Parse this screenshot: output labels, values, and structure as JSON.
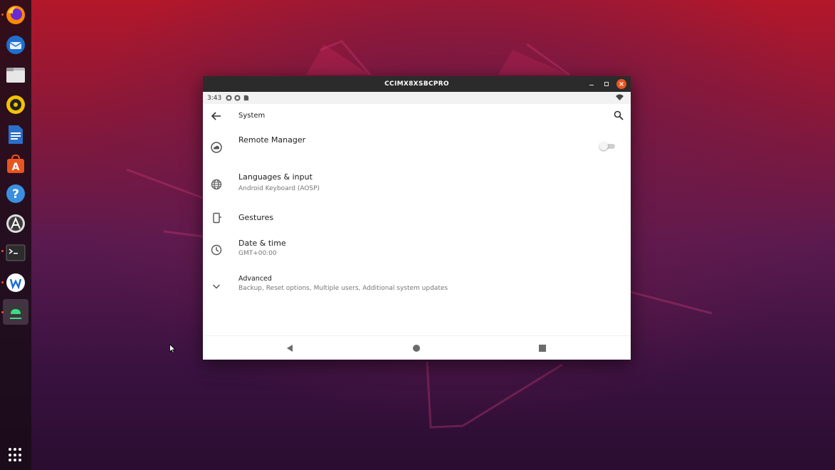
{
  "window": {
    "title": "CCIMX8XSBCPRO",
    "controls": [
      "minimize",
      "maximize",
      "close"
    ]
  },
  "status_bar": {
    "time": "3:43",
    "icons": [
      "notification-icon",
      "notification-icon",
      "sd-card-icon",
      "wifi-icon"
    ]
  },
  "app_bar": {
    "title": "System"
  },
  "settings": [
    {
      "label": "Remote Manager",
      "summary": "",
      "icon": "cloud-icon",
      "has_toggle": true,
      "toggle_on": false
    },
    {
      "label": "Languages & input",
      "summary": "Android Keyboard (AOSP)",
      "icon": "globe-icon"
    },
    {
      "label": "Gestures",
      "summary": "",
      "icon": "phone-gesture-icon"
    },
    {
      "label": "Date & time",
      "summary": "GMT+00:00",
      "icon": "clock-icon"
    },
    {
      "label": "Advanced",
      "summary": "Backup, Reset options, Multiple users, Additional system updates",
      "icon": "chevron-down-icon"
    }
  ],
  "nav_bar": [
    "back",
    "home",
    "recents"
  ],
  "dock": {
    "apps": [
      "firefox",
      "thunderbird",
      "files",
      "rhythmbox",
      "libreoffice-writer",
      "ubuntu-software",
      "help",
      "app-store",
      "terminal",
      "webstorm",
      "android-emulator"
    ],
    "accent": "#e95420"
  }
}
